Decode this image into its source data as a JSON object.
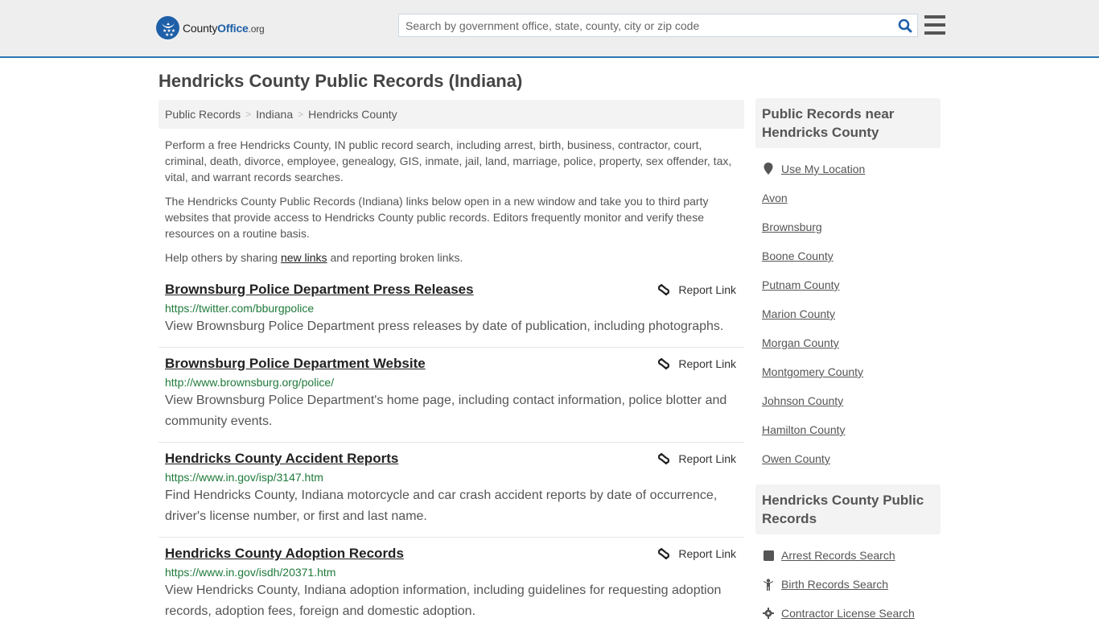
{
  "header": {
    "logo": {
      "county": "County",
      "office": "Office",
      "org": ".org"
    },
    "search": {
      "placeholder": "Search by government office, state, county, city or zip code",
      "value": ""
    },
    "icons": {
      "search": "search-icon",
      "menu": "hamburger-menu-icon"
    }
  },
  "page": {
    "title": "Hendricks County Public Records (Indiana)"
  },
  "breadcrumb": [
    {
      "label": "Public Records"
    },
    {
      "label": "Indiana"
    },
    {
      "label": "Hendricks County"
    }
  ],
  "intro": {
    "p1": "Perform a free Hendricks County, IN public record search, including arrest, birth, business, contractor, court, criminal, death, divorce, employee, genealogy, GIS, inmate, jail, land, marriage, police, property, sex offender, tax, vital, and warrant records searches.",
    "p2": "The Hendricks County Public Records (Indiana) links below open in a new window and take you to third party websites that provide access to Hendricks County public records. Editors frequently monitor and verify these resources on a routine basis.",
    "p3_before": "Help others by sharing ",
    "p3_link": "new links",
    "p3_after": " and reporting broken links."
  },
  "report_label": "Report Link",
  "records": [
    {
      "title": "Brownsburg Police Department Press Releases",
      "url": "https://twitter.com/bburgpolice",
      "description": "View Brownsburg Police Department press releases by date of publication, including photographs."
    },
    {
      "title": "Brownsburg Police Department Website",
      "url": "http://www.brownsburg.org/police/",
      "description": "View Brownsburg Police Department's home page, including contact information, police blotter and community events."
    },
    {
      "title": "Hendricks County Accident Reports",
      "url": "https://www.in.gov/isp/3147.htm",
      "description": "Find Hendricks County, Indiana motorcycle and car crash accident reports by date of occurrence, driver's license number, or first and last name."
    },
    {
      "title": "Hendricks County Adoption Records",
      "url": "https://www.in.gov/isdh/20371.htm",
      "description": "View Hendricks County, Indiana adoption information, including guidelines for requesting adoption records, adoption fees, foreign and domestic adoption."
    }
  ],
  "sidebar": {
    "nearby": {
      "heading": "Public Records near Hendricks County",
      "use_location": "Use My Location",
      "places": [
        "Avon",
        "Brownsburg",
        "Boone County",
        "Putnam County",
        "Marion County",
        "Morgan County",
        "Montgomery County",
        "Johnson County",
        "Hamilton County",
        "Owen County"
      ]
    },
    "categories": {
      "heading": "Hendricks County Public Records",
      "items": [
        {
          "label": "Arrest Records Search",
          "icon": "arrest-icon"
        },
        {
          "label": "Birth Records Search",
          "icon": "baby-icon"
        },
        {
          "label": "Contractor License Search",
          "icon": "gear-icon"
        }
      ]
    }
  },
  "colors": {
    "accent": "#2f76b5",
    "brand": "#1e5fa8",
    "url_green": "#1f7a3a",
    "header_bg": "#eeeeee"
  }
}
